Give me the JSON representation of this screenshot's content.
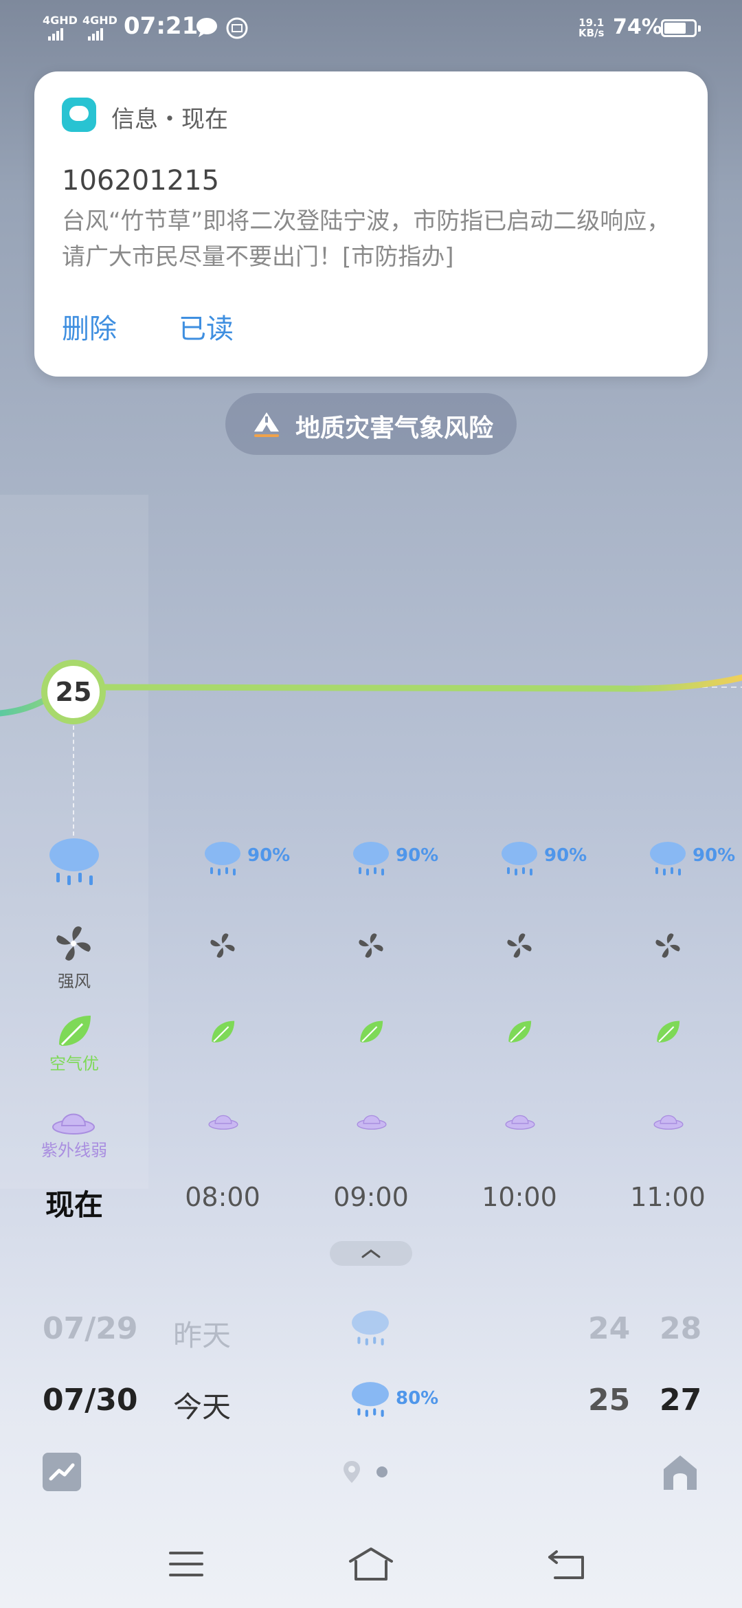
{
  "status_bar": {
    "network1": "4GHD",
    "network2": "4GHD",
    "time": "07:21",
    "net_speed_value": "19.1",
    "net_speed_unit": "KB/s",
    "battery_percent": "74%",
    "battery_level": 0.74
  },
  "notification": {
    "app_label": "信息・现在",
    "sender": "106201215",
    "body": "台风“竹节草”即将二次登陆宁波，市防指已启动二级响应，请广大市民尽量不要出门！[市防指办]",
    "delete_label": "删除",
    "read_label": "已读"
  },
  "alert": {
    "label": "地质灾害气象风险",
    "icon": "mountain-warning-icon"
  },
  "current": {
    "temperature": "25",
    "wind_label": "强风",
    "air_label": "空气优",
    "uv_label": "紫外线弱"
  },
  "hourly": [
    {
      "time": "现在",
      "precip": ""
    },
    {
      "time": "08:00",
      "precip": "90%"
    },
    {
      "time": "09:00",
      "precip": "90%"
    },
    {
      "time": "10:00",
      "precip": "90%"
    },
    {
      "time": "11:00",
      "precip": "90%"
    }
  ],
  "daily": [
    {
      "date": "07/29",
      "day": "昨天",
      "precip": "",
      "low": "24",
      "high": "28"
    },
    {
      "date": "07/30",
      "day": "今天",
      "precip": "80%",
      "low": "25",
      "high": "27"
    }
  ],
  "colors": {
    "accent_blue": "#4f96ea",
    "air_green": "#7ed957",
    "uv_purple": "#a98ee0",
    "temp_line": "#a8d96c"
  },
  "icons": [
    "rain-cloud-icon",
    "fan-wind-icon",
    "leaf-icon",
    "hat-uv-icon",
    "chart-icon",
    "home-icon",
    "location-pin-icon",
    "menu-icon",
    "home-nav-icon",
    "back-icon"
  ]
}
